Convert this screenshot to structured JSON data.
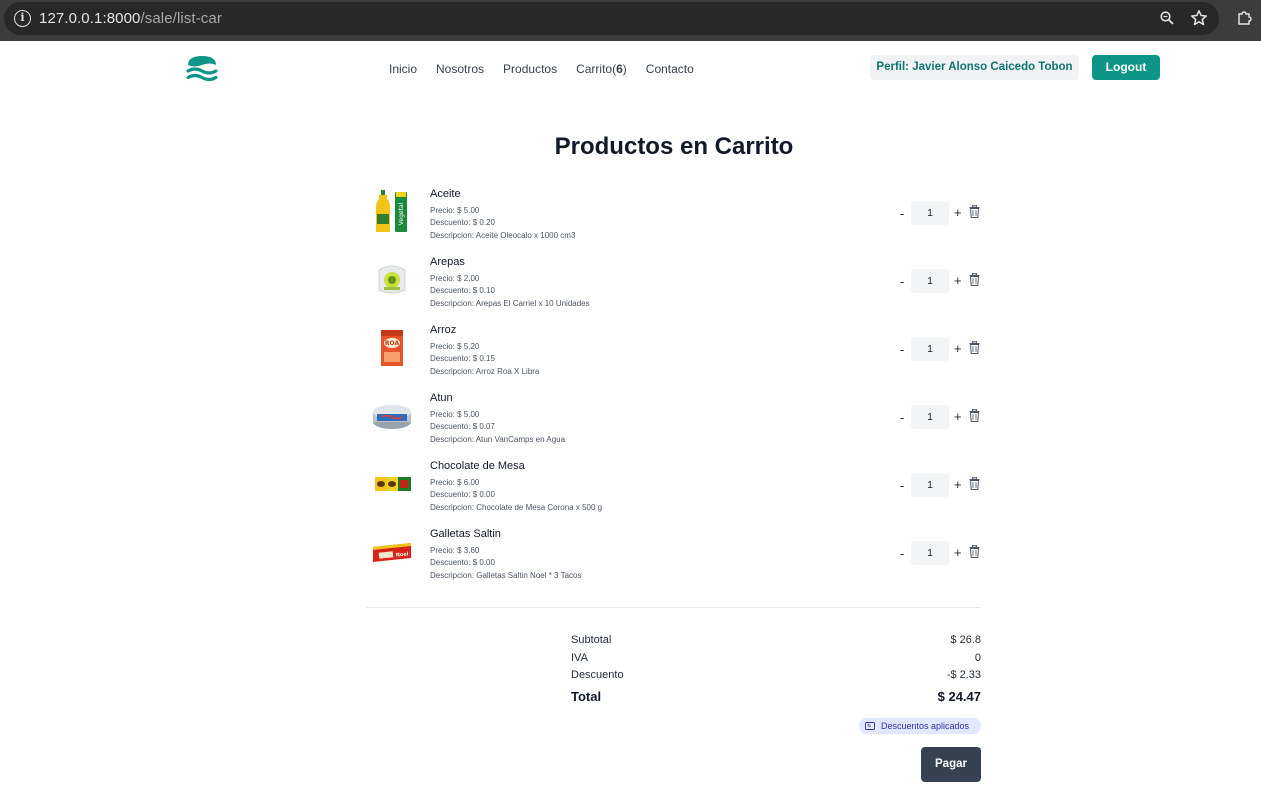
{
  "browser": {
    "url_host": "127.0.0.1:8000",
    "url_path": "/sale/list-car"
  },
  "nav": {
    "links": [
      {
        "label": "Inicio"
      },
      {
        "label": "Nosotros"
      },
      {
        "label": "Productos"
      },
      {
        "label": "Carrito(",
        "count": "6",
        "suffix": ")"
      },
      {
        "label": "Contacto"
      }
    ],
    "profile": "Perfil: Javier Alonso Caicedo Tobon",
    "logout": "Logout"
  },
  "page": {
    "title": "Productos en Carrito"
  },
  "cart": {
    "items": [
      {
        "name": "Aceite",
        "price": "Precio: $ 5.00",
        "discount": "Descuento: $ 0.20",
        "description": "Descripcion: Aceite Oleocalo x 1000 cm3",
        "qty": "1",
        "thumb_icon": "oil-bottles-image"
      },
      {
        "name": "Arepas",
        "price": "Precio: $ 2.00",
        "discount": "Descuento: $ 0.10",
        "description": "Descripcion: Arepas El Carriel x 10 Unidades",
        "qty": "1",
        "thumb_icon": "arepas-bag-image"
      },
      {
        "name": "Arroz",
        "price": "Precio: $ 5.20",
        "discount": "Descuento: $ 0.15",
        "description": "Descripcion: Arroz Roa X Libra",
        "qty": "1",
        "thumb_icon": "rice-bag-image"
      },
      {
        "name": "Atun",
        "price": "Precio: $ 5.00",
        "discount": "Descuento: $ 0.07",
        "description": "Descripcion: Atun VanCamps en Agua",
        "qty": "1",
        "thumb_icon": "tuna-can-image"
      },
      {
        "name": "Chocolate de Mesa",
        "price": "Precio: $ 6.00",
        "discount": "Descuento: $ 0.00",
        "description": "Descripcion: Chocolate de Mesa Corona x 500 g",
        "qty": "1",
        "thumb_icon": "chocolate-bar-image"
      },
      {
        "name": "Galletas Saltin",
        "price": "Precio: $ 3.60",
        "discount": "Descuento: $ 0.00",
        "description": "Descripcion: Galletas Saltin Noel * 3 Tacos",
        "qty": "1",
        "thumb_icon": "crackers-pack-image"
      }
    ],
    "minus": "-",
    "plus": "+"
  },
  "summary": {
    "subtotal_label": "Subtotal",
    "subtotal_value": "$ 26.8",
    "iva_label": "IVA",
    "iva_value": "0",
    "discount_label": "Descuento",
    "discount_value": "-$ 2.33",
    "total_label": "Total",
    "total_value": "$ 24.47"
  },
  "badge": "Descuentos aplicados",
  "pay": "Pagar",
  "colors": {
    "brand": "#0f9488",
    "profile_text": "#0f766e",
    "pay_button": "#374151",
    "badge_bg": "#e0e7ff"
  }
}
